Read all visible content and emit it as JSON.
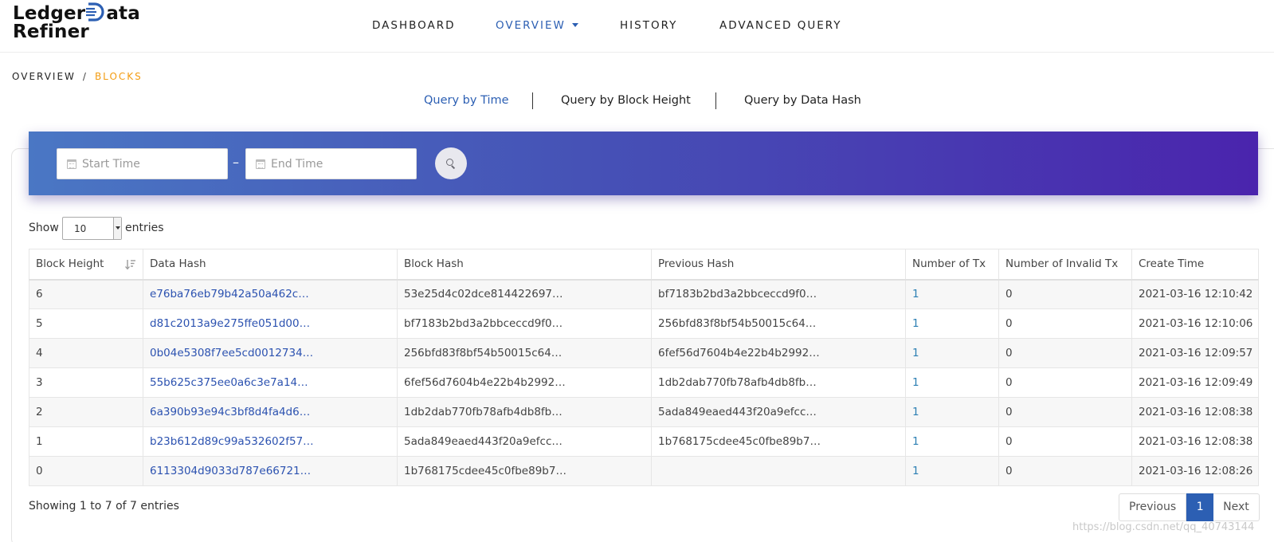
{
  "logo": {
    "line1_a": "Ledger",
    "line1_b": "ata",
    "line2": "Refiner"
  },
  "nav": {
    "items": [
      {
        "label": "DASHBOARD"
      },
      {
        "label": "OVERVIEW"
      },
      {
        "label": "HISTORY"
      },
      {
        "label": "ADVANCED QUERY"
      }
    ],
    "active": "OVERVIEW"
  },
  "breadcrumb": {
    "parent": "OVERVIEW",
    "separator": "/",
    "current": "BLOCKS"
  },
  "query_tabs": [
    {
      "label": "Query by Time",
      "active": true
    },
    {
      "label": "Query by Block Height",
      "active": false
    },
    {
      "label": "Query by Data Hash",
      "active": false
    }
  ],
  "filter": {
    "start_placeholder": "Start Time",
    "end_placeholder": "End Time",
    "separator": "–"
  },
  "length": {
    "show_label": "Show",
    "value": "10",
    "entries_label": "entries"
  },
  "table": {
    "columns": [
      "Block Height",
      "Data Hash",
      "Block Hash",
      "Previous Hash",
      "Number of Tx",
      "Number of Invalid Tx",
      "Create Time"
    ],
    "rows": [
      [
        "6",
        "e76ba76eb79b42a50a462c…",
        "53e25d4c02dce814422697…",
        "bf7183b2bd3a2bbceccd9f0…",
        "1",
        "0",
        "2021-03-16 12:10:42"
      ],
      [
        "5",
        "d81c2013a9e275ffe051d00…",
        "bf7183b2bd3a2bbceccd9f0…",
        "256bfd83f8bf54b50015c64…",
        "1",
        "0",
        "2021-03-16 12:10:06"
      ],
      [
        "4",
        "0b04e5308f7ee5cd0012734…",
        "256bfd83f8bf54b50015c64…",
        "6fef56d7604b4e22b4b2992…",
        "1",
        "0",
        "2021-03-16 12:09:57"
      ],
      [
        "3",
        "55b625c375ee0a6c3e7a14…",
        "6fef56d7604b4e22b4b2992…",
        "1db2dab770fb78afb4db8fb…",
        "1",
        "0",
        "2021-03-16 12:09:49"
      ],
      [
        "2",
        "6a390b93e94c3bf8d4fa4d6…",
        "1db2dab770fb78afb4db8fb…",
        "5ada849eaed443f20a9efcc…",
        "1",
        "0",
        "2021-03-16 12:08:38"
      ],
      [
        "1",
        "b23b612d89c99a532602f57…",
        "5ada849eaed443f20a9efcc…",
        "1b768175cdee45c0fbe89b7…",
        "1",
        "0",
        "2021-03-16 12:08:38"
      ],
      [
        "0",
        "6113304d9033d787e66721…",
        "1b768175cdee45c0fbe89b7…",
        "",
        "1",
        "0",
        "2021-03-16 12:08:26"
      ]
    ]
  },
  "footer": {
    "info": "Showing 1 to 7 of 7 entries",
    "prev_label": "Previous",
    "page": "1",
    "next_label": "Next"
  },
  "watermark": "https://blog.csdn.net/qq_40743144",
  "colors": {
    "accent": "#2c5fb3",
    "breadcrumb_current": "#f39c12",
    "banner_start": "#4a77c4",
    "banner_end": "#4a24ad"
  }
}
